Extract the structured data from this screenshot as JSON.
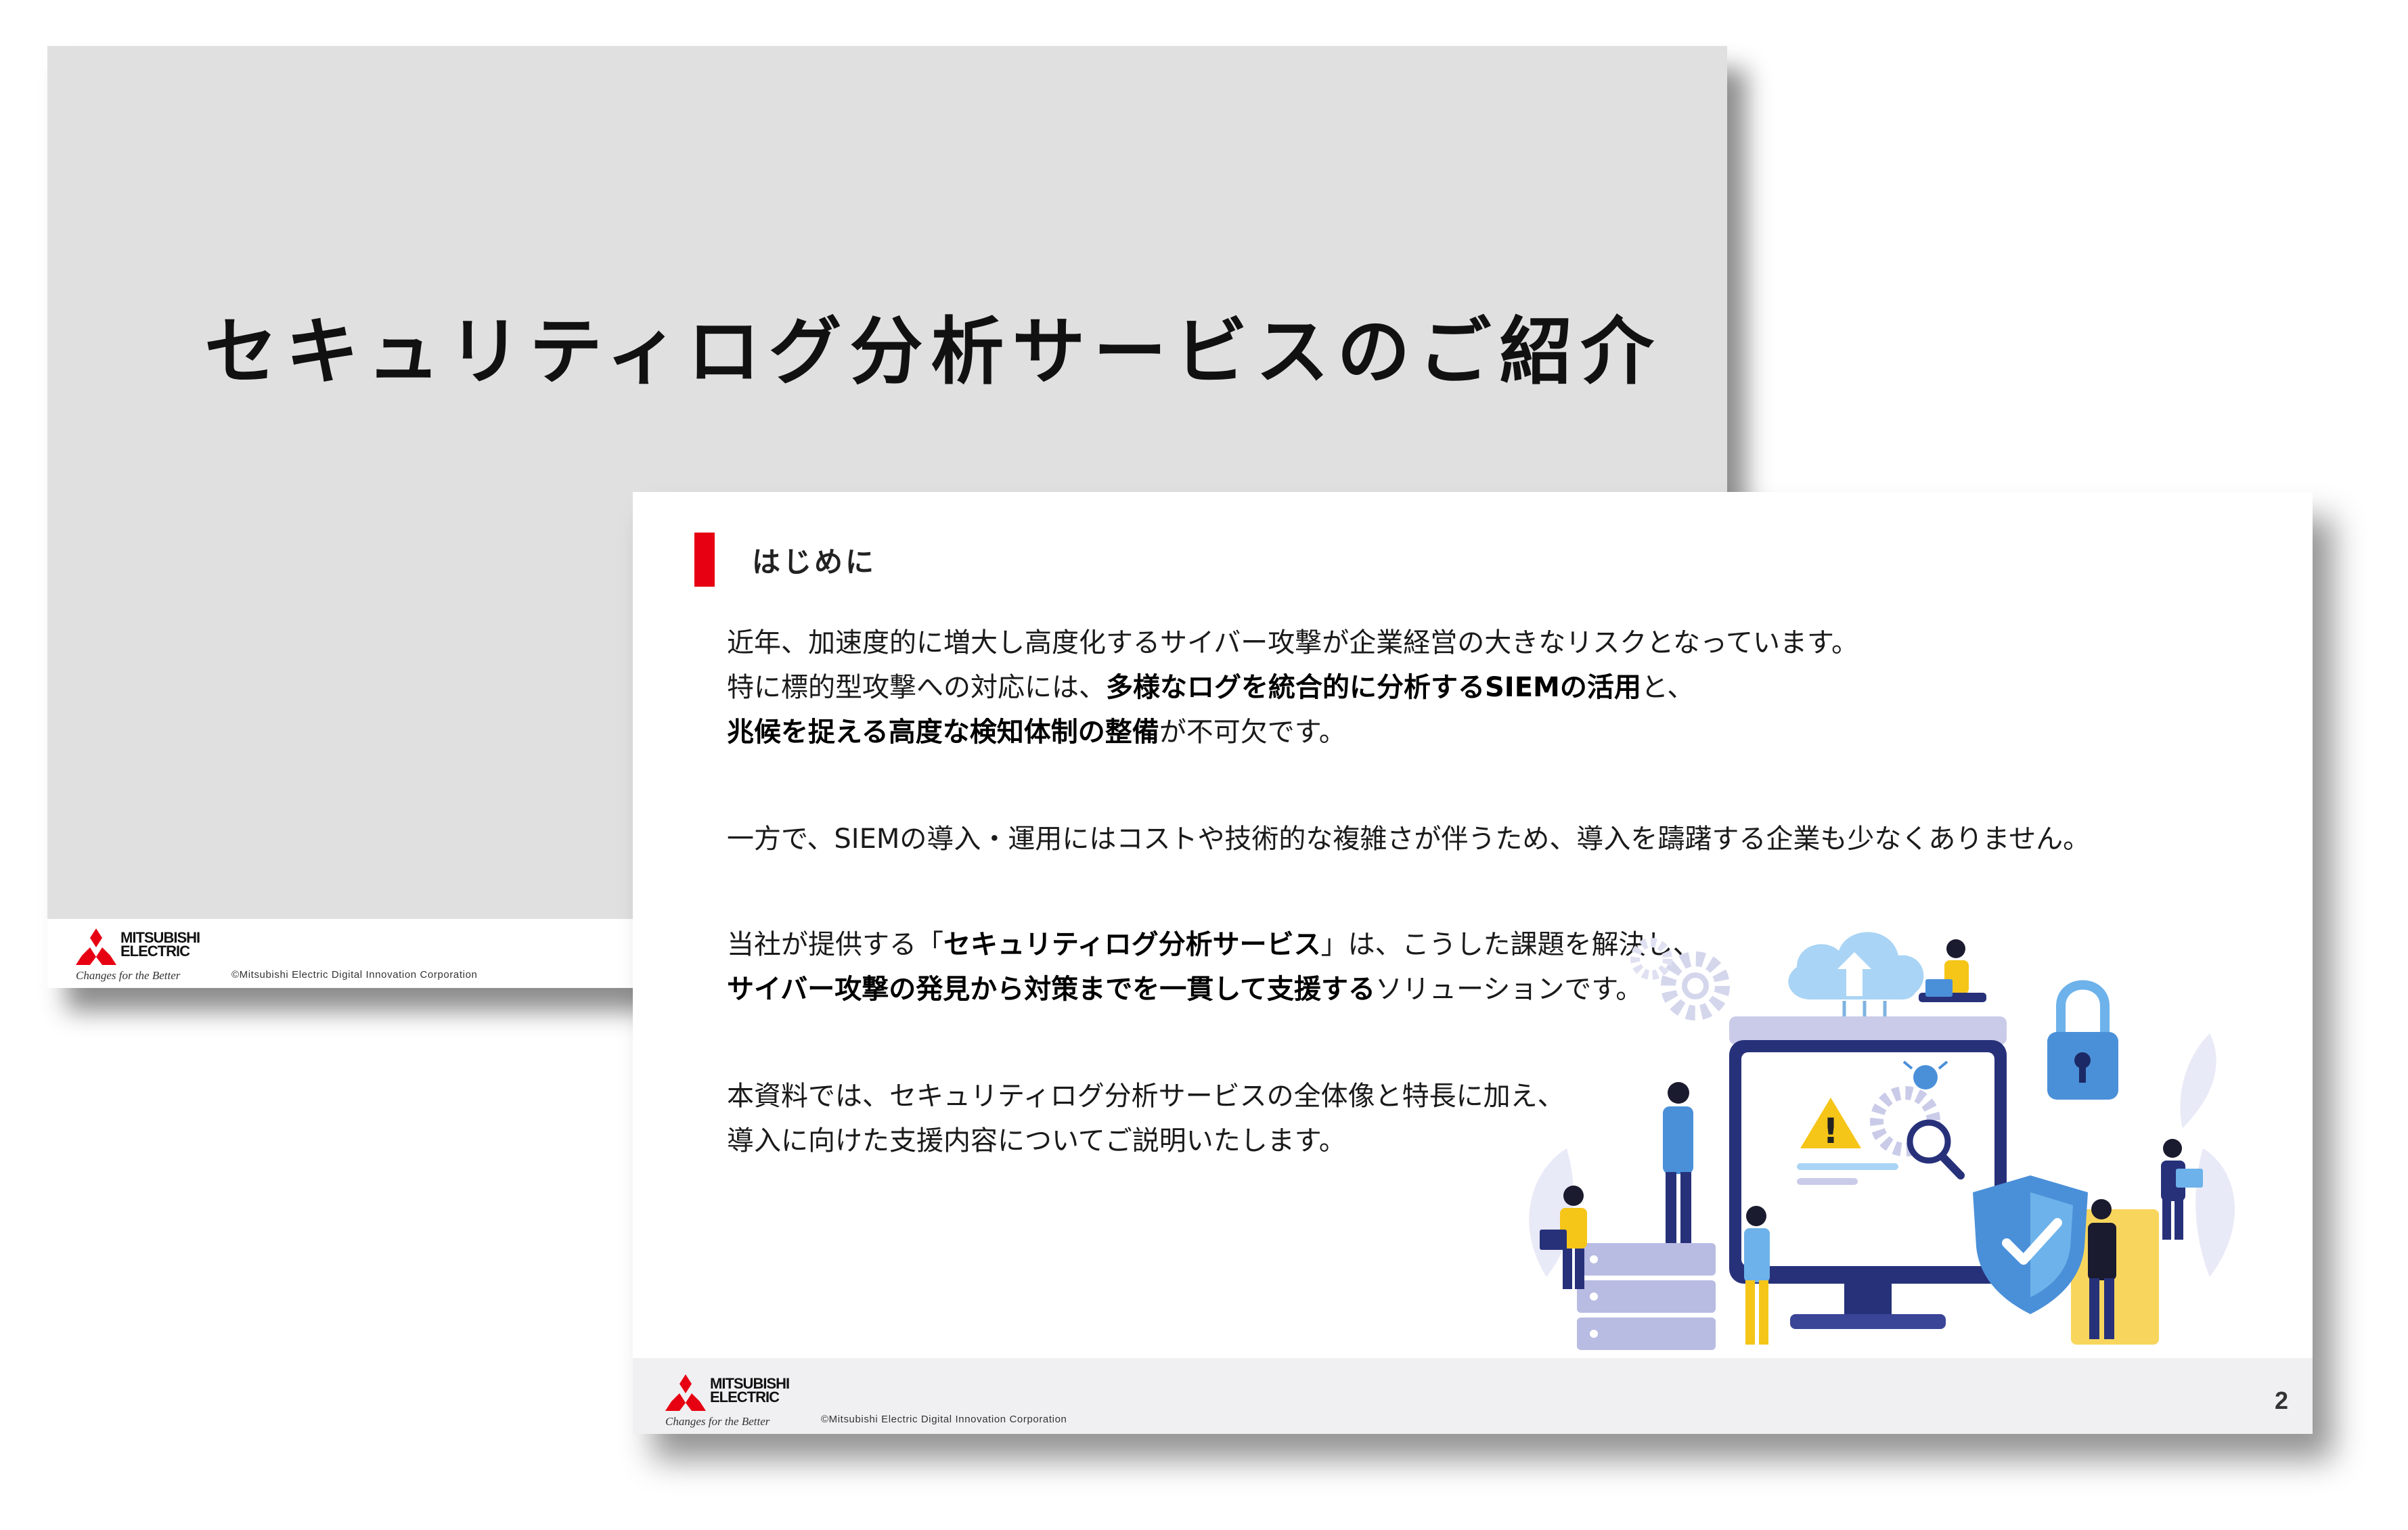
{
  "cover_slide": {
    "title": "セキュリティログ分析サービスのご紹介",
    "logo_brand_line1": "MITSUBISHI",
    "logo_brand_line2": "ELECTRIC",
    "logo_tagline": "Changes for the Better",
    "copyright": "©Mitsubishi Electric Digital Innovation Corporation"
  },
  "intro_slide": {
    "heading": "はじめに",
    "p1_line1": "近年、加速度的に増大し高度化するサイバー攻撃が企業経営の大きなリスクとなっています。",
    "p1_line2_a": "特に標的型攻撃への対応には、",
    "p1_line2_b": "多様なログを統合的に分析するSIEMの活用",
    "p1_line2_c": "と、",
    "p1_line3_a": "兆候を捉える高度な検知体制の整備",
    "p1_line3_b": "が不可欠です。",
    "p2_line1": "一方で、SIEMの導入・運用にはコストや技術的な複雑さが伴うため、導入を躊躇する企業も少なくありません。",
    "p3_line1_a": "当社が提供する「",
    "p3_line1_b": "セキュリティログ分析サービス",
    "p3_line1_c": "」は、こうした課題を解決し、",
    "p3_line2_a": "サイバー攻撃の発見から対策までを一貫して支援する",
    "p3_line2_b": "ソリューションです。",
    "p4_line1": "本資料では、セキュリティログ分析サービスの全体像と特長に加え、",
    "p4_line2": "導入に向けた支援内容についてご説明いたします。",
    "page_number": "2",
    "logo_brand_line1": "MITSUBISHI",
    "logo_brand_line2": "ELECTRIC",
    "logo_tagline": "Changes for the Better",
    "copyright": "©Mitsubishi Electric Digital Innovation Corporation"
  },
  "illustration": {
    "warning_symbol": "!"
  },
  "colors": {
    "accent_red": "#e60012",
    "cover_gray": "#e0e0e0",
    "footer_gray": "#f0f0f2",
    "illustration_navy": "#27317a",
    "illustration_blue": "#4a90d9",
    "illustration_yellow": "#f5c518",
    "illustration_lavender": "#c9cbe8"
  },
  "icons": [
    "mitsubishi-logo-icon",
    "cloud-upload-icon",
    "gear-icon",
    "padlock-icon",
    "warning-icon",
    "magnifier-icon",
    "bug-icon",
    "shield-check-icon"
  ]
}
